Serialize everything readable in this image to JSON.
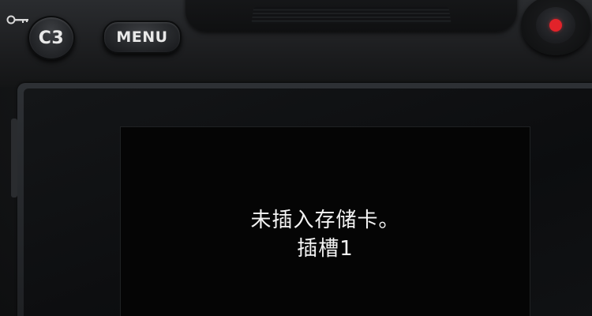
{
  "camera": {
    "buttons": {
      "c3_label": "C3",
      "menu_label": "MENU"
    },
    "key_icon": "key-icon",
    "record_color": "#e2232a"
  },
  "screen": {
    "message_line1": "未插入存储卡。",
    "message_line2": "插槽1"
  }
}
